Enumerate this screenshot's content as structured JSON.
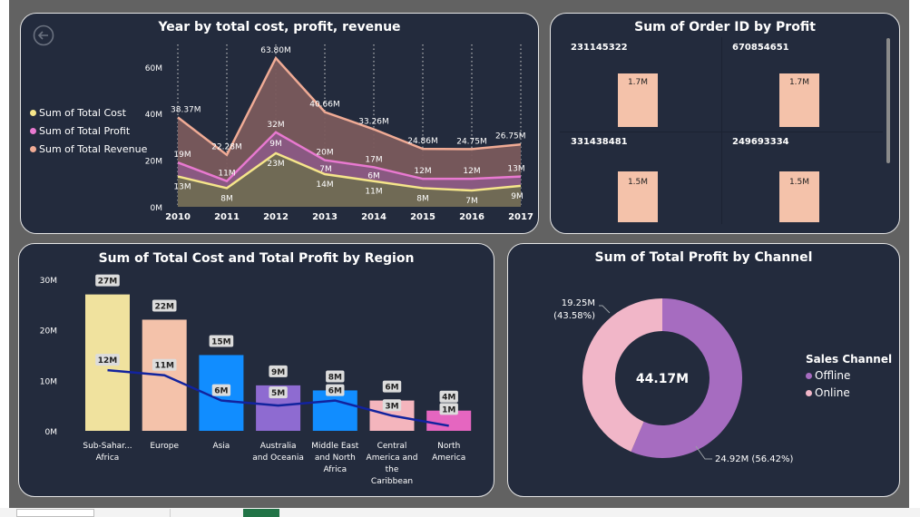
{
  "charts": {
    "year": {
      "title": "Year by total cost, profit, revenue",
      "back_icon": "back-arrow-icon",
      "yticks": [
        "0M",
        "20M",
        "40M",
        "60M"
      ],
      "legend": [
        {
          "name": "Sum of Total Cost",
          "color": "#f5e58a"
        },
        {
          "name": "Sum of Total Profit",
          "color": "#e879d0"
        },
        {
          "name": "Sum of Total Revenue",
          "color": "#f0ab95"
        }
      ]
    },
    "order": {
      "title": "Sum of Order ID by Profit",
      "tiles": [
        {
          "id": "231145322",
          "value_label": "1.7M"
        },
        {
          "id": "670854651",
          "value_label": "1.7M"
        },
        {
          "id": "331438481",
          "value_label": "1.5M"
        },
        {
          "id": "249693334",
          "value_label": "1.5M"
        }
      ]
    },
    "region": {
      "title": "Sum of Total Cost and Total Profit by Region",
      "yticks": [
        "0M",
        "10M",
        "20M",
        "30M"
      ]
    },
    "channel": {
      "title": "Sum of Total Profit by Channel",
      "center_label": "44.17M",
      "legend_title": "Sales Channel",
      "slice_labels": [
        "24.92M (56.42%)",
        "19.25M",
        "(43.58%)"
      ]
    }
  },
  "chart_data": [
    {
      "type": "area",
      "title": "Year by total cost, profit, revenue",
      "x": [
        "2010",
        "2011",
        "2012",
        "2013",
        "2014",
        "2015",
        "2016",
        "2017"
      ],
      "ylim": [
        0,
        70
      ],
      "series": [
        {
          "name": "Sum of Total Cost",
          "color": "#f5e58a",
          "values": [
            13,
            8,
            23,
            14,
            11,
            8,
            7,
            9
          ],
          "labels": [
            "13M",
            "8M",
            "23M",
            "14M",
            "11M",
            "8M",
            "7M",
            "9M"
          ]
        },
        {
          "name": "Sum of Total Profit",
          "color": "#e879d0",
          "values": [
            19,
            11,
            32,
            20,
            17,
            12,
            12,
            13
          ],
          "labels": [
            "19M",
            "11M",
            "32M",
            "20M",
            "17M",
            "12M",
            "12M",
            "13M"
          ]
        },
        {
          "name": "Sum of Total Revenue",
          "color": "#f0ab95",
          "values": [
            38.37,
            22.28,
            63.8,
            40.66,
            33.26,
            24.86,
            24.75,
            26.75
          ],
          "labels": [
            "38.37M",
            "22.28M",
            "63.80M",
            "40.66M",
            "33.26M",
            "24.86M",
            "24.75M",
            "26.75M"
          ]
        }
      ],
      "extra_labels": [
        "9M",
        "7M",
        "6M"
      ]
    },
    {
      "type": "bar",
      "title": "Sum of Order ID by Profit",
      "categories": [
        "231145322",
        "670854651",
        "331438481",
        "249693334"
      ],
      "values": [
        1.7,
        1.7,
        1.5,
        1.5
      ],
      "color": "#f4c2aa"
    },
    {
      "type": "bar",
      "title": "Sum of Total Cost and Total Profit by Region",
      "categories": [
        [
          "Sub-Sahar...",
          "Africa"
        ],
        [
          "Europe"
        ],
        [
          "Asia"
        ],
        [
          "Australia",
          "and Oceania"
        ],
        [
          "Middle East",
          "and North",
          "Africa"
        ],
        [
          "Central",
          "America and",
          "the",
          "Caribbean"
        ],
        [
          "North",
          "America"
        ]
      ],
      "ylim": [
        0,
        30
      ],
      "series": [
        {
          "name": "Total Cost",
          "values": [
            27,
            22,
            15,
            9,
            8,
            6,
            4
          ],
          "labels": [
            "27M",
            "22M",
            "15M",
            "9M",
            "8M",
            "6M",
            "4M"
          ],
          "colors": [
            "#f0e29e",
            "#f4c2aa",
            "#118dff",
            "#8e6bd1",
            "#118dff",
            "#f4b5bd",
            "#e566c0"
          ]
        },
        {
          "name": "Total Profit",
          "values": [
            12,
            11,
            6,
            5,
            6,
            3,
            1
          ],
          "labels": [
            "12M",
            "11M",
            "6M",
            "5M",
            "6M",
            "3M",
            "1M"
          ],
          "color": "#12239e"
        }
      ]
    },
    {
      "type": "pie",
      "title": "Sum of Total Profit by Channel",
      "legend_title": "Sales Channel",
      "total": 44.17,
      "slices": [
        {
          "name": "Offline",
          "value": 24.92,
          "percent": 56.42,
          "color": "#a66cc0"
        },
        {
          "name": "Online",
          "value": 19.25,
          "percent": 43.58,
          "color": "#f1b6c8"
        }
      ]
    }
  ]
}
